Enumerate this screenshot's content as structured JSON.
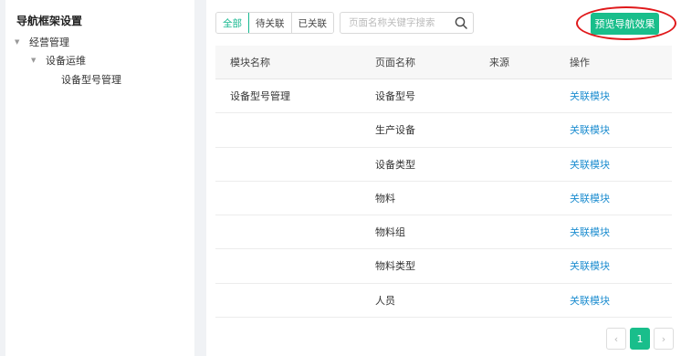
{
  "sidebar": {
    "title": "导航框架设置",
    "tree": [
      {
        "label": "经营管理",
        "level": 0,
        "caret": "▼"
      },
      {
        "label": "设备运维",
        "level": 1,
        "caret": "▼"
      },
      {
        "label": "设备型号管理",
        "level": 2,
        "caret": ""
      }
    ]
  },
  "toolbar": {
    "filters": [
      "全部",
      "待关联",
      "已关联"
    ],
    "active_filter": "全部",
    "search_placeholder": "页面名称关键字搜索",
    "search_value": "",
    "preview_label": "预览导航效果"
  },
  "table": {
    "columns": [
      "模块名称",
      "页面名称",
      "来源",
      "操作"
    ],
    "rows": [
      [
        "设备型号管理",
        "设备型号",
        "",
        "关联模块"
      ],
      [
        "",
        "生产设备",
        "",
        "关联模块"
      ],
      [
        "",
        "设备类型",
        "",
        "关联模块"
      ],
      [
        "",
        "物料",
        "",
        "关联模块"
      ],
      [
        "",
        "物料组",
        "",
        "关联模块"
      ],
      [
        "",
        "物料类型",
        "",
        "关联模块"
      ],
      [
        "",
        "人员",
        "",
        "关联模块"
      ]
    ]
  },
  "pagination": {
    "prev": "‹",
    "current": "1",
    "next": "›"
  },
  "colors": {
    "accent": "#19be8b",
    "link": "#1f8ed0",
    "highlight": "#e0191b"
  },
  "icons": [
    "search-icon",
    "chevron-left-icon",
    "chevron-right-icon",
    "caret-down-icon"
  ]
}
